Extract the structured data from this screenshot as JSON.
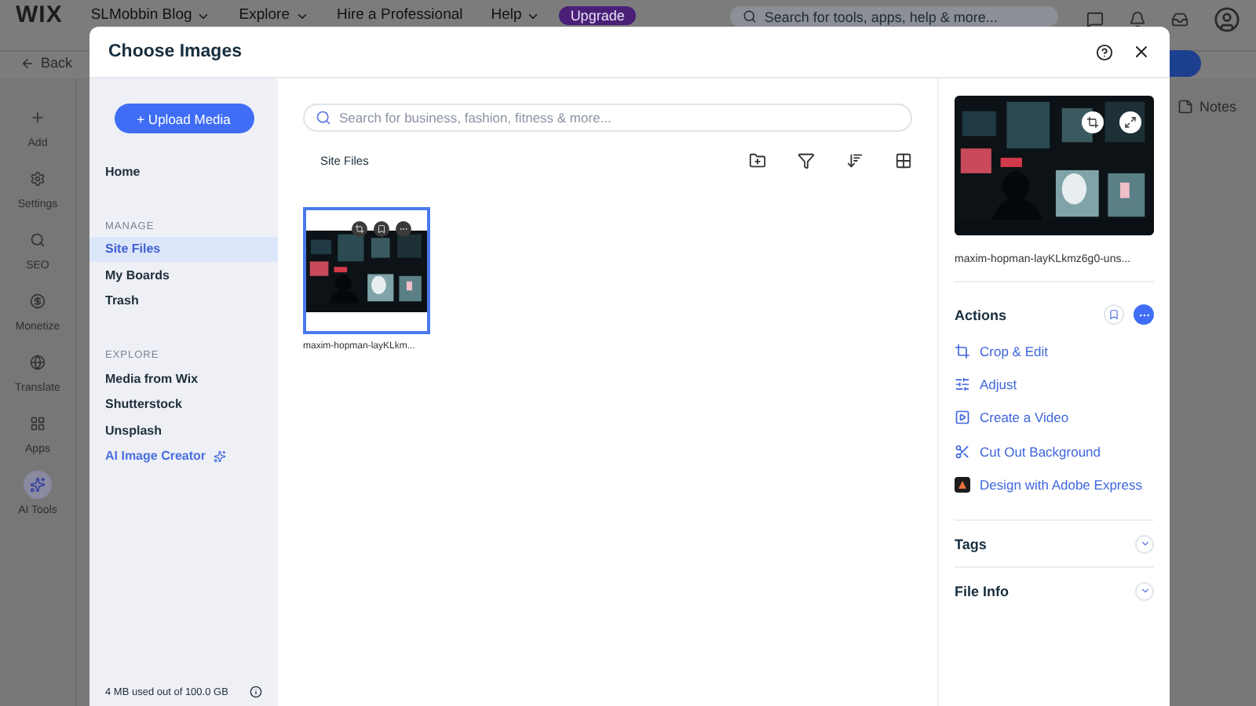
{
  "topbar": {
    "logo": "WIX",
    "menus": [
      {
        "label": "SLMobbin Blog",
        "dropdown": true
      },
      {
        "label": "Explore",
        "dropdown": true
      },
      {
        "label": "Hire a Professional",
        "dropdown": false
      },
      {
        "label": "Help",
        "dropdown": true
      }
    ],
    "upgrade": "Upgrade",
    "search": {
      "placeholder": "Search for tools, apps, help & more..."
    }
  },
  "editor_bar": {
    "back": "Back",
    "notes": "Notes"
  },
  "rail": [
    {
      "label": "Add",
      "kind": "add",
      "selected": false
    },
    {
      "label": "Settings",
      "kind": "settings",
      "selected": false
    },
    {
      "label": "SEO",
      "kind": "seo",
      "selected": false
    },
    {
      "label": "Monetize",
      "kind": "monetize",
      "selected": false
    },
    {
      "label": "Translate",
      "kind": "translate",
      "selected": false
    },
    {
      "label": "Apps",
      "kind": "apps",
      "selected": false
    },
    {
      "label": "AI Tools",
      "kind": "ai",
      "selected": true
    }
  ],
  "dialog": {
    "title": "Choose Images",
    "sidebar": {
      "upload_button": "+ Upload Media",
      "home": {
        "label": "Home",
        "selected": false
      },
      "sections": [
        {
          "heading": "MANAGE",
          "items": [
            {
              "label": "Site Files",
              "kind": "item",
              "selected": true
            },
            {
              "label": "My Boards",
              "kind": "item",
              "selected": false
            },
            {
              "label": "Trash",
              "kind": "item",
              "selected": false
            }
          ]
        },
        {
          "heading": "EXPLORE",
          "items": [
            {
              "label": "Media from Wix",
              "kind": "item",
              "selected": false
            },
            {
              "label": "Shutterstock",
              "kind": "item",
              "selected": false
            },
            {
              "label": "Unsplash",
              "kind": "item",
              "selected": false
            },
            {
              "label": "AI Image Creator",
              "kind": "link",
              "selected": false
            }
          ]
        }
      ],
      "storage": "4 MB used out of 100.0 GB"
    },
    "search": {
      "placeholder": "Search for business, fashion, fitness & more..."
    },
    "breadcrumb": "Site Files",
    "files": [
      {
        "name": "maxim-hopman-layKLkm...",
        "selected": true
      }
    ],
    "details": {
      "file_name": "maxim-hopman-layKLkmz6g0-uns...",
      "actions_title": "Actions",
      "actions": [
        {
          "label": "Crop & Edit",
          "kind": "crop"
        },
        {
          "label": "Adjust",
          "kind": "adjust"
        },
        {
          "label": "Create a Video",
          "kind": "video"
        },
        {
          "label": "Cut Out Background",
          "kind": "cutout"
        },
        {
          "label": "Design with Adobe Express",
          "kind": "adobe"
        }
      ],
      "sections": [
        {
          "label": "Tags",
          "expanded": false
        },
        {
          "label": "File Info",
          "expanded": false
        }
      ]
    }
  }
}
